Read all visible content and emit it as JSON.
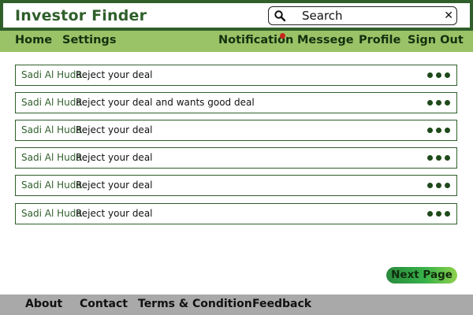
{
  "app": {
    "title": "Investor Finder"
  },
  "search": {
    "placeholder": "Search",
    "clear_icon": "close-icon",
    "icon": "search-icon"
  },
  "nav": {
    "left": [
      {
        "label": "Home"
      },
      {
        "label": "Settings"
      }
    ],
    "right": [
      {
        "label": "Notification"
      },
      {
        "label": "Messege"
      },
      {
        "label": "Profile"
      },
      {
        "label": "Sign Out"
      }
    ],
    "notification_dot_color": "#c9261b"
  },
  "notifications": [
    {
      "sender": "Sadi Al Huda",
      "message": "Reject your deal"
    },
    {
      "sender": "Sadi Al Huda",
      "message": "Reject your deal and wants good deal"
    },
    {
      "sender": "Sadi Al Huda",
      "message": "Reject your deal"
    },
    {
      "sender": "Sadi Al Huda",
      "message": "Reject your deal"
    },
    {
      "sender": "Sadi Al Huda",
      "message": "Reject your deal"
    },
    {
      "sender": "Sadi Al Huda",
      "message": "Reject your deal"
    }
  ],
  "pagination": {
    "next_label": "Next Page"
  },
  "footer": {
    "links": [
      {
        "label": "About"
      },
      {
        "label": "Contact"
      },
      {
        "label": "Terms & Condition"
      },
      {
        "label": "Feedback"
      }
    ]
  },
  "colors": {
    "brand": "#2f5f2b",
    "navbar": "#9ac267",
    "footer": "#a9a9a9"
  }
}
